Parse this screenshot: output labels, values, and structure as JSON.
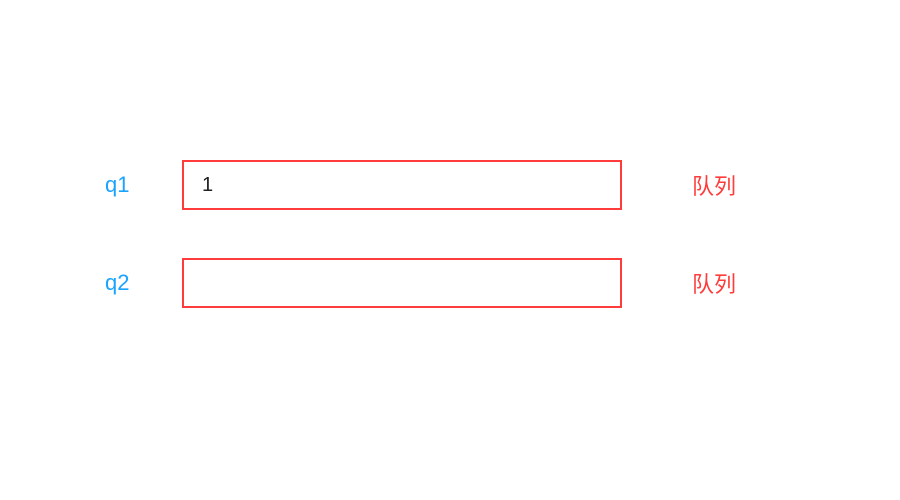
{
  "queues": [
    {
      "name": "q1",
      "content": "1",
      "type_label": "队列"
    },
    {
      "name": "q2",
      "content": "",
      "type_label": "队列"
    }
  ]
}
